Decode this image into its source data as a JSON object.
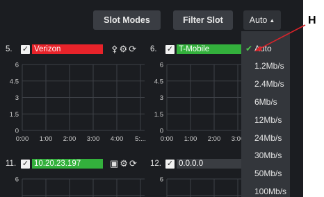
{
  "toolbar": {
    "slot_modes_label": "Slot Modes",
    "filter_slot_label": "Filter Slot",
    "auto_label": "Auto"
  },
  "slots": [
    {
      "number": "5.",
      "carrier": "Verizon",
      "color": "#e8232a"
    },
    {
      "number": "6.",
      "carrier": "T-Mobile",
      "color": "#33b03c"
    },
    {
      "number": "11.",
      "carrier": "10.20.23.197",
      "color": "#33b03c"
    },
    {
      "number": "12.",
      "carrier": "0.0.0.0",
      "color": "#3a3d42"
    }
  ],
  "chart_data": [
    {
      "type": "line",
      "yticks": [
        "6",
        "4.5",
        "3",
        "1.5",
        "0"
      ],
      "xticks": [
        "0:00",
        "1:00",
        "2:00",
        "3:00",
        "4:00",
        "5:..."
      ],
      "ylim": [
        0,
        6
      ],
      "series": []
    },
    {
      "type": "line",
      "yticks": [
        "6",
        "4.5",
        "3",
        "1.5",
        "0"
      ],
      "xticks": [
        "0:00",
        "1:00",
        "2:00",
        "3:00"
      ],
      "ylim": [
        0,
        6
      ],
      "series": []
    },
    {
      "type": "line",
      "yticks": [
        "6"
      ],
      "xticks": [],
      "ylim": [
        0,
        6
      ],
      "series": []
    },
    {
      "type": "line",
      "yticks": [
        "6"
      ],
      "xticks": [],
      "ylim": [
        0,
        6
      ],
      "series": []
    }
  ],
  "dropdown": {
    "options": [
      "Auto",
      "1.2Mb/s",
      "2.4Mb/s",
      "6Mb/s",
      "12Mb/s",
      "24Mb/s",
      "30Mb/s",
      "50Mb/s",
      "100Mb/s"
    ],
    "selected": "Auto"
  },
  "callout": {
    "letter": "H"
  },
  "colors": {
    "background": "#1b1d21",
    "button": "#3a3d43",
    "check": "#4ec24e",
    "arrow": "#d8232a"
  }
}
